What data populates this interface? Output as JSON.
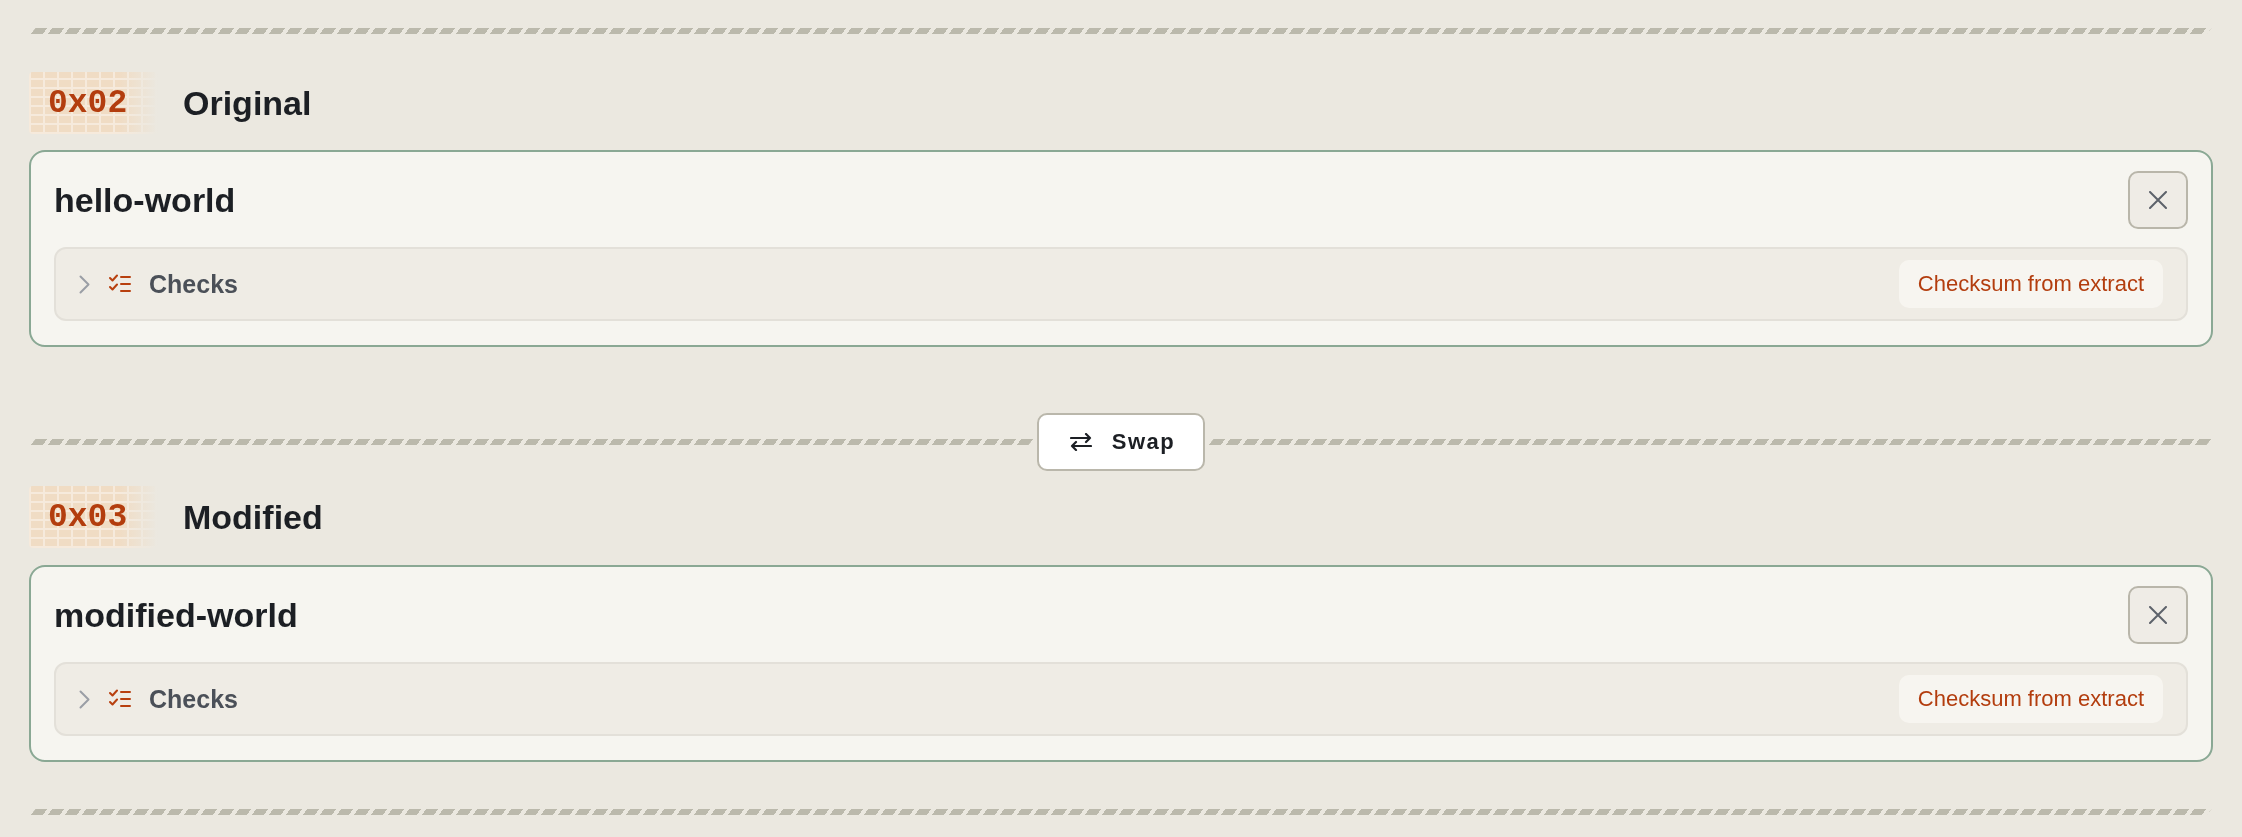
{
  "sections": [
    {
      "code": "0x02",
      "title": "Original",
      "file": {
        "name": "hello-world",
        "checks": {
          "label": "Checks",
          "expanded": false,
          "source": "Checksum from extract"
        }
      }
    },
    {
      "code": "0x03",
      "title": "Modified",
      "file": {
        "name": "modified-world",
        "checks": {
          "label": "Checks",
          "expanded": false,
          "source": "Checksum from extract"
        }
      }
    }
  ],
  "swap_button": {
    "label": "Swap"
  }
}
